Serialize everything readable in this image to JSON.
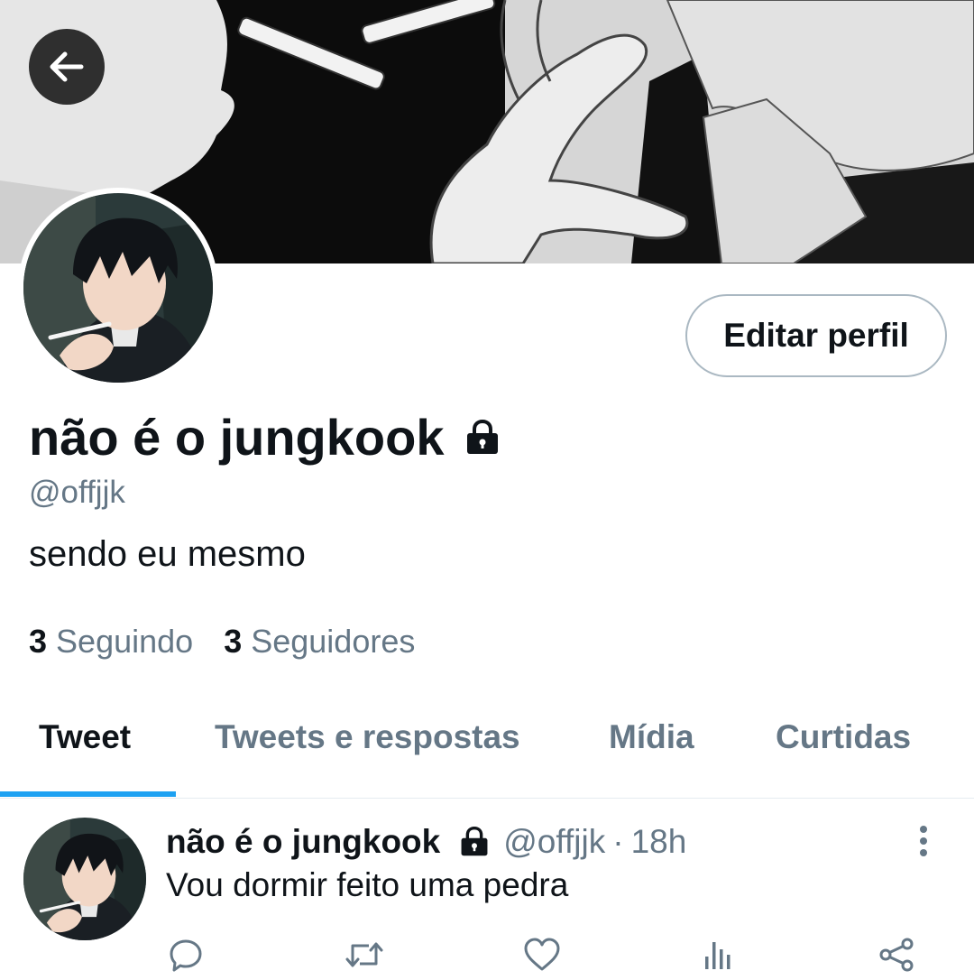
{
  "header": {
    "back_icon": "arrow-left-icon",
    "banner_description_icon": "banner-image"
  },
  "profile": {
    "display_name": "não é o jungkook",
    "locked_icon": "lock-icon",
    "handle": "@offjjk",
    "bio": "sendo eu mesmo",
    "edit_button_label": "Editar perfil",
    "following_count": "3",
    "following_label": "Seguindo",
    "followers_count": "3",
    "followers_label": "Seguidores"
  },
  "tabs": [
    {
      "label": "Tweet",
      "active": true
    },
    {
      "label": "Tweets e respostas",
      "active": false
    },
    {
      "label": "Mídia",
      "active": false
    },
    {
      "label": "Curtidas",
      "active": false
    }
  ],
  "tweet": {
    "name": "não é o jungkook",
    "handle": "@offjjk",
    "separator": "·",
    "time": "18h",
    "text": "Vou dormir feito uma pedra",
    "actions": [
      "reply-icon",
      "retweet-icon",
      "like-icon",
      "analytics-icon",
      "share-icon"
    ],
    "more_icon": "more-vertical-icon"
  },
  "colors": {
    "accent": "#1da1f2",
    "secondary_text": "#657786",
    "primary_text": "#0f1419",
    "border": "#aab8c2"
  }
}
